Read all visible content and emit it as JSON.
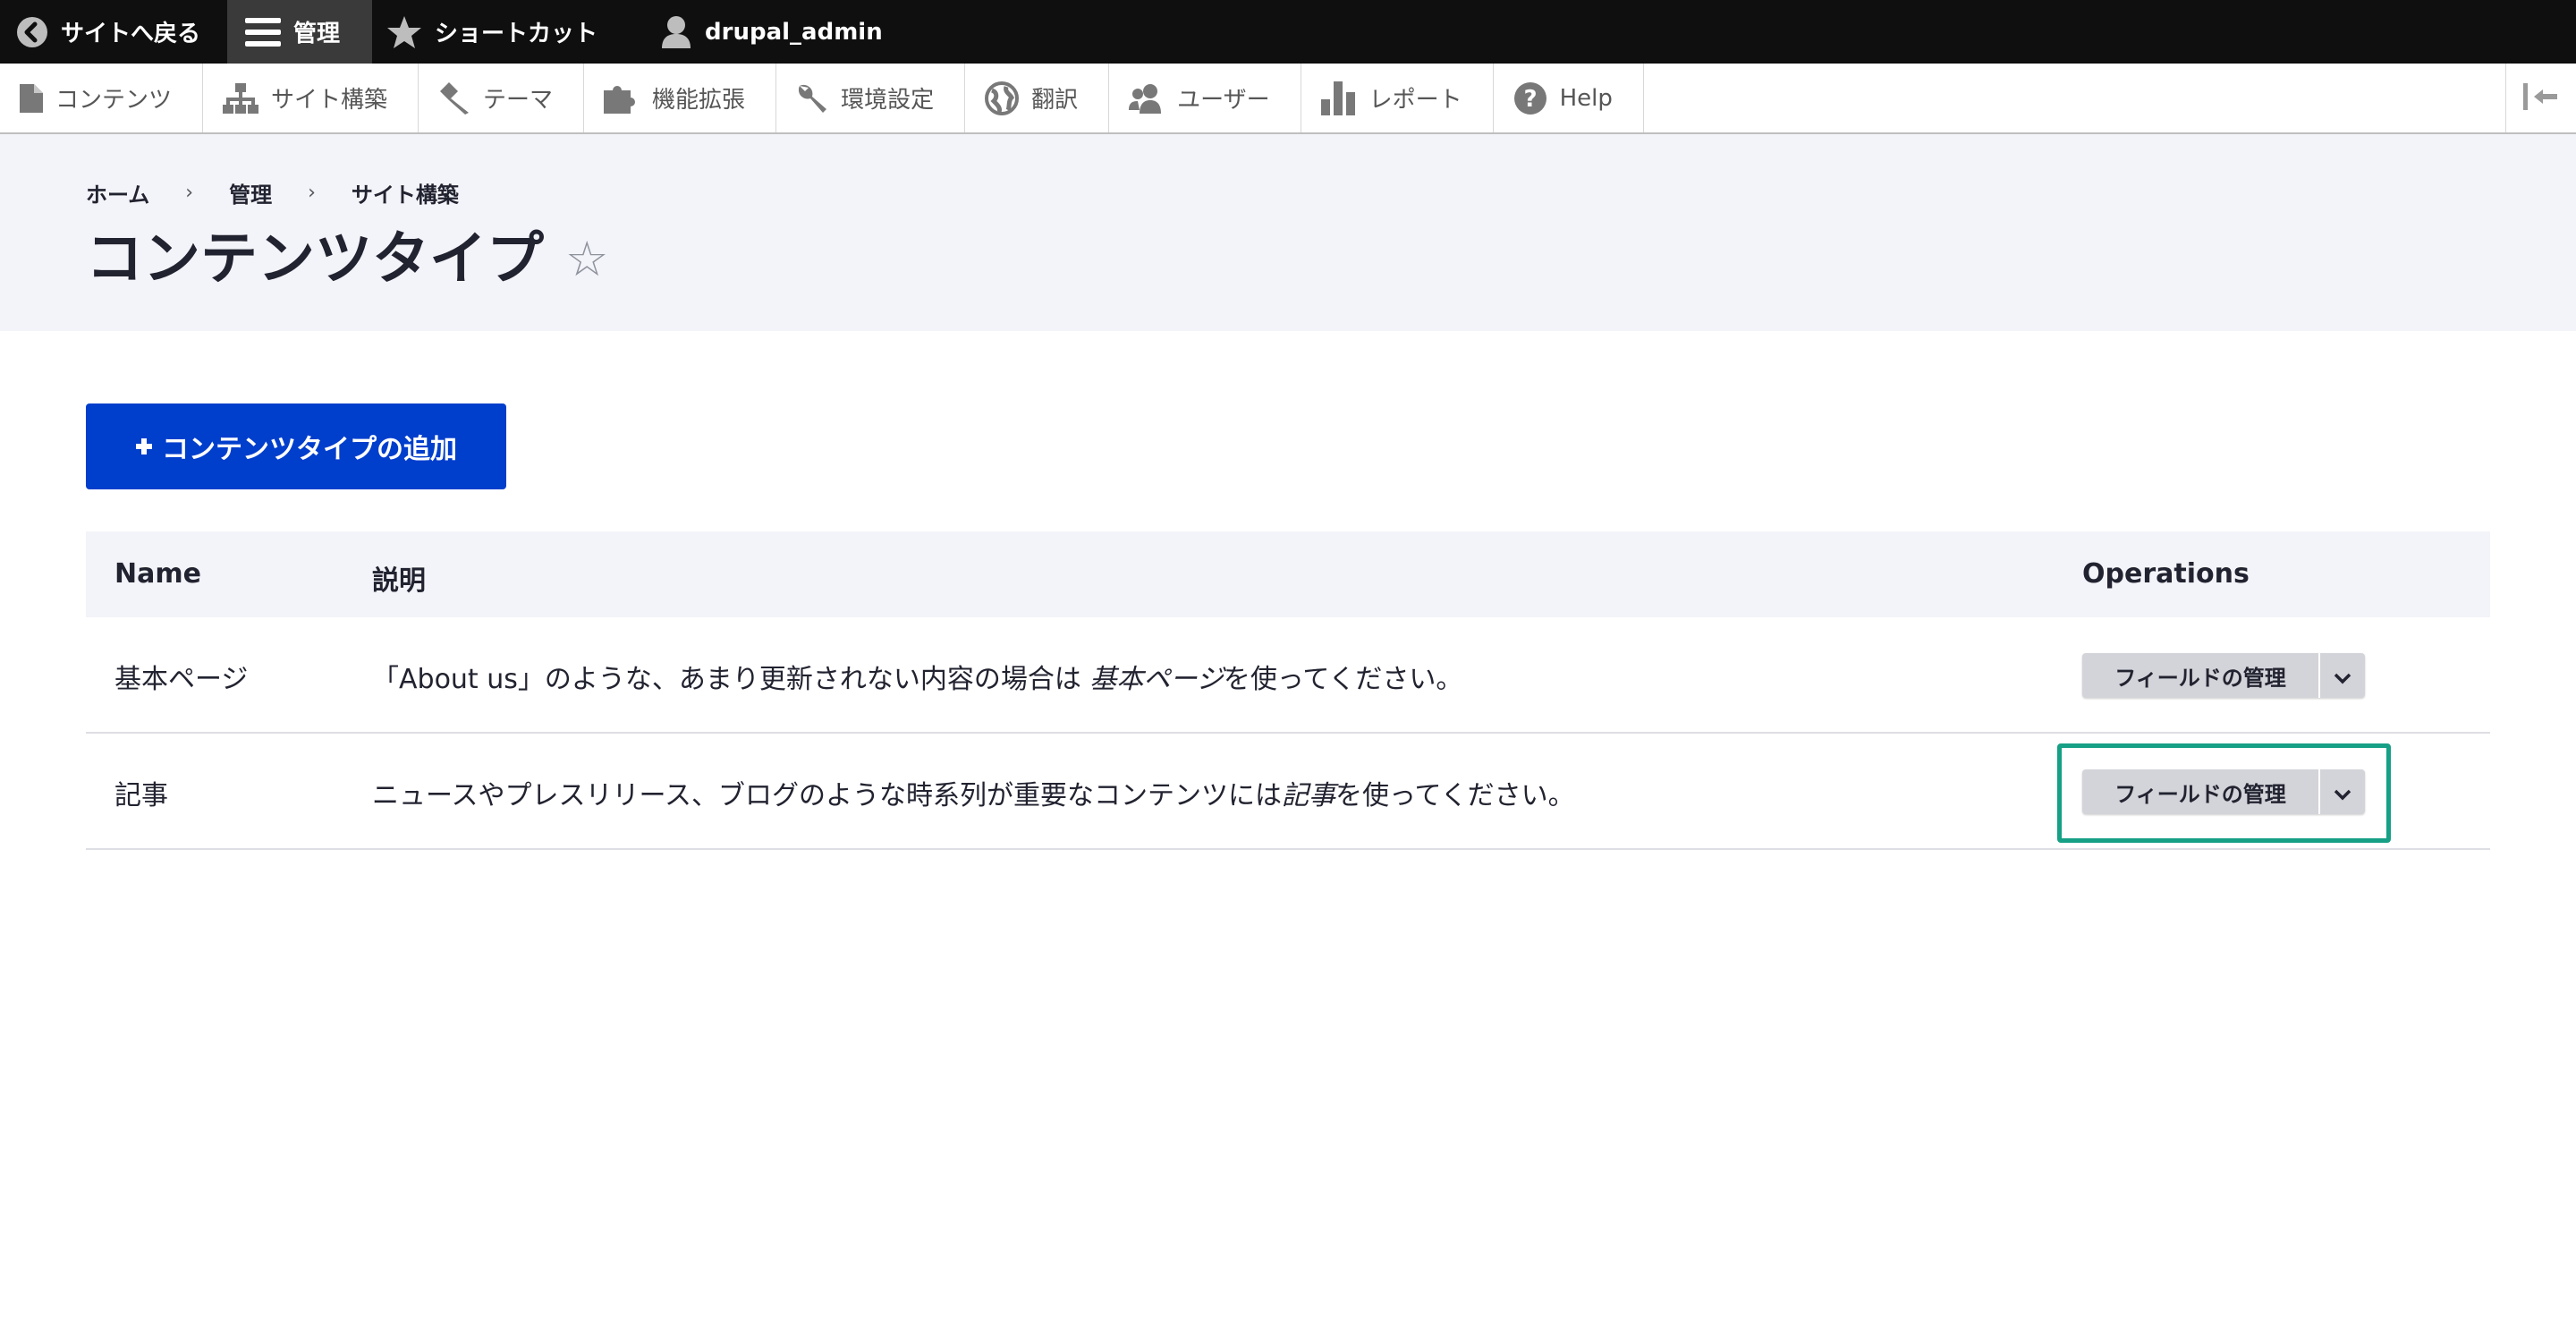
{
  "toolbar": {
    "back": "サイトへ戻る",
    "manage": "管理",
    "shortcuts": "ショートカット",
    "user": "drupal_admin"
  },
  "tray": {
    "items": [
      {
        "label": "コンテンツ",
        "icon": "file-icon"
      },
      {
        "label": "サイト構築",
        "icon": "sitemap-icon"
      },
      {
        "label": "テーマ",
        "icon": "paintbrush-icon"
      },
      {
        "label": "機能拡張",
        "icon": "puzzle-icon"
      },
      {
        "label": "環境設定",
        "icon": "wrench-icon"
      },
      {
        "label": "翻訳",
        "icon": "globe-icon"
      },
      {
        "label": "ユーザー",
        "icon": "people-icon"
      },
      {
        "label": "レポート",
        "icon": "bar-chart-icon"
      },
      {
        "label": "Help",
        "icon": "help-icon"
      }
    ]
  },
  "breadcrumb": [
    "ホーム",
    "管理",
    "サイト構築"
  ],
  "page": {
    "title": "コンテンツタイプ",
    "star": "☆",
    "add_button": "コンテンツタイプの追加"
  },
  "table": {
    "headers": {
      "name": "Name",
      "description": "説明",
      "operations": "Operations"
    },
    "rows": [
      {
        "name": "基本ページ",
        "desc_before": "「About us」のような、あまり更新されない内容の場合は ",
        "desc_em": "基本ページ",
        "desc_after": "を使ってください。",
        "operation": "フィールドの管理"
      },
      {
        "name": "記事",
        "desc_before": "ニュースやプレスリリース、ブログのような時系列が重要なコンテンツには",
        "desc_em": "記事",
        "desc_after": "を使ってください。",
        "operation": "フィールドの管理"
      }
    ]
  },
  "colors": {
    "toolbar_bg": "#0f0f0f",
    "primary_button": "#003ecc",
    "highlight": "#16a085",
    "header_bg": "#f3f4f9"
  }
}
